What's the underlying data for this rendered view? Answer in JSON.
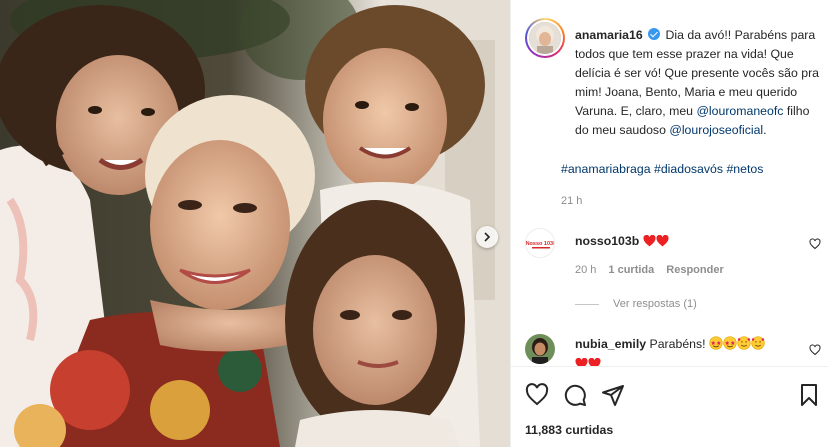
{
  "post": {
    "username": "anamaria16",
    "caption_segments": {
      "c1": "Dia da avó!! Parabéns para todos que tem esse prazer na vida! Que delícia é ser vó! Que presente vocês são pra mim! Joana, Bento, Maria e meu querido Varuna. E, claro, meu ",
      "m1": "@louromaneofc",
      "c2": " filho do meu saudoso ",
      "m2": "@lourojoseoficial",
      "c3": "."
    },
    "hashtags": [
      "#anamariabraga",
      "#diadosavós",
      "#netos"
    ],
    "time": "21 h"
  },
  "comments": [
    {
      "username": "nosso103b",
      "text": "",
      "emojis": [
        "red-heart",
        "red-heart"
      ],
      "avatar_label": "Nosso 103b",
      "time": "20 h",
      "likes": "1 curtida",
      "reply": "Responder",
      "see_replies": "Ver respostas (1)"
    },
    {
      "username": "nubia_emily",
      "text": "Parabéns!",
      "emojis": [
        "star-struck",
        "star-struck",
        "smiling-hearts",
        "smiling-hearts",
        "red-heart",
        "red-heart"
      ]
    }
  ],
  "footer": {
    "likes_count": "11,883",
    "likes_label": "curtidas"
  },
  "colors": {
    "link": "#00376b",
    "muted": "#8e8e8e",
    "heart": "#ed2024",
    "verified": "#3897f0"
  }
}
